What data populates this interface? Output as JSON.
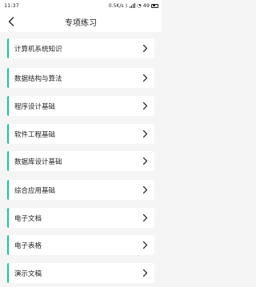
{
  "status_bar": {
    "time": "11:37",
    "net_speed": "0.5K/s",
    "battery": "49"
  },
  "header": {
    "title": "专项练习"
  },
  "subjects": [
    {
      "label": "计算机系统知识"
    },
    {
      "label": "数据结构与算法"
    },
    {
      "label": "程序设计基础"
    },
    {
      "label": "软件工程基础"
    },
    {
      "label": "数据库设计基础"
    },
    {
      "label": "综合应用基础"
    },
    {
      "label": "电子文档"
    },
    {
      "label": "电子表格"
    },
    {
      "label": "演示文稿"
    }
  ],
  "colors": {
    "accent": "#17c79a",
    "background": "#f5f5f5"
  },
  "icons": {
    "back": "back-arrow-icon",
    "item": "chevron-right-icon"
  }
}
